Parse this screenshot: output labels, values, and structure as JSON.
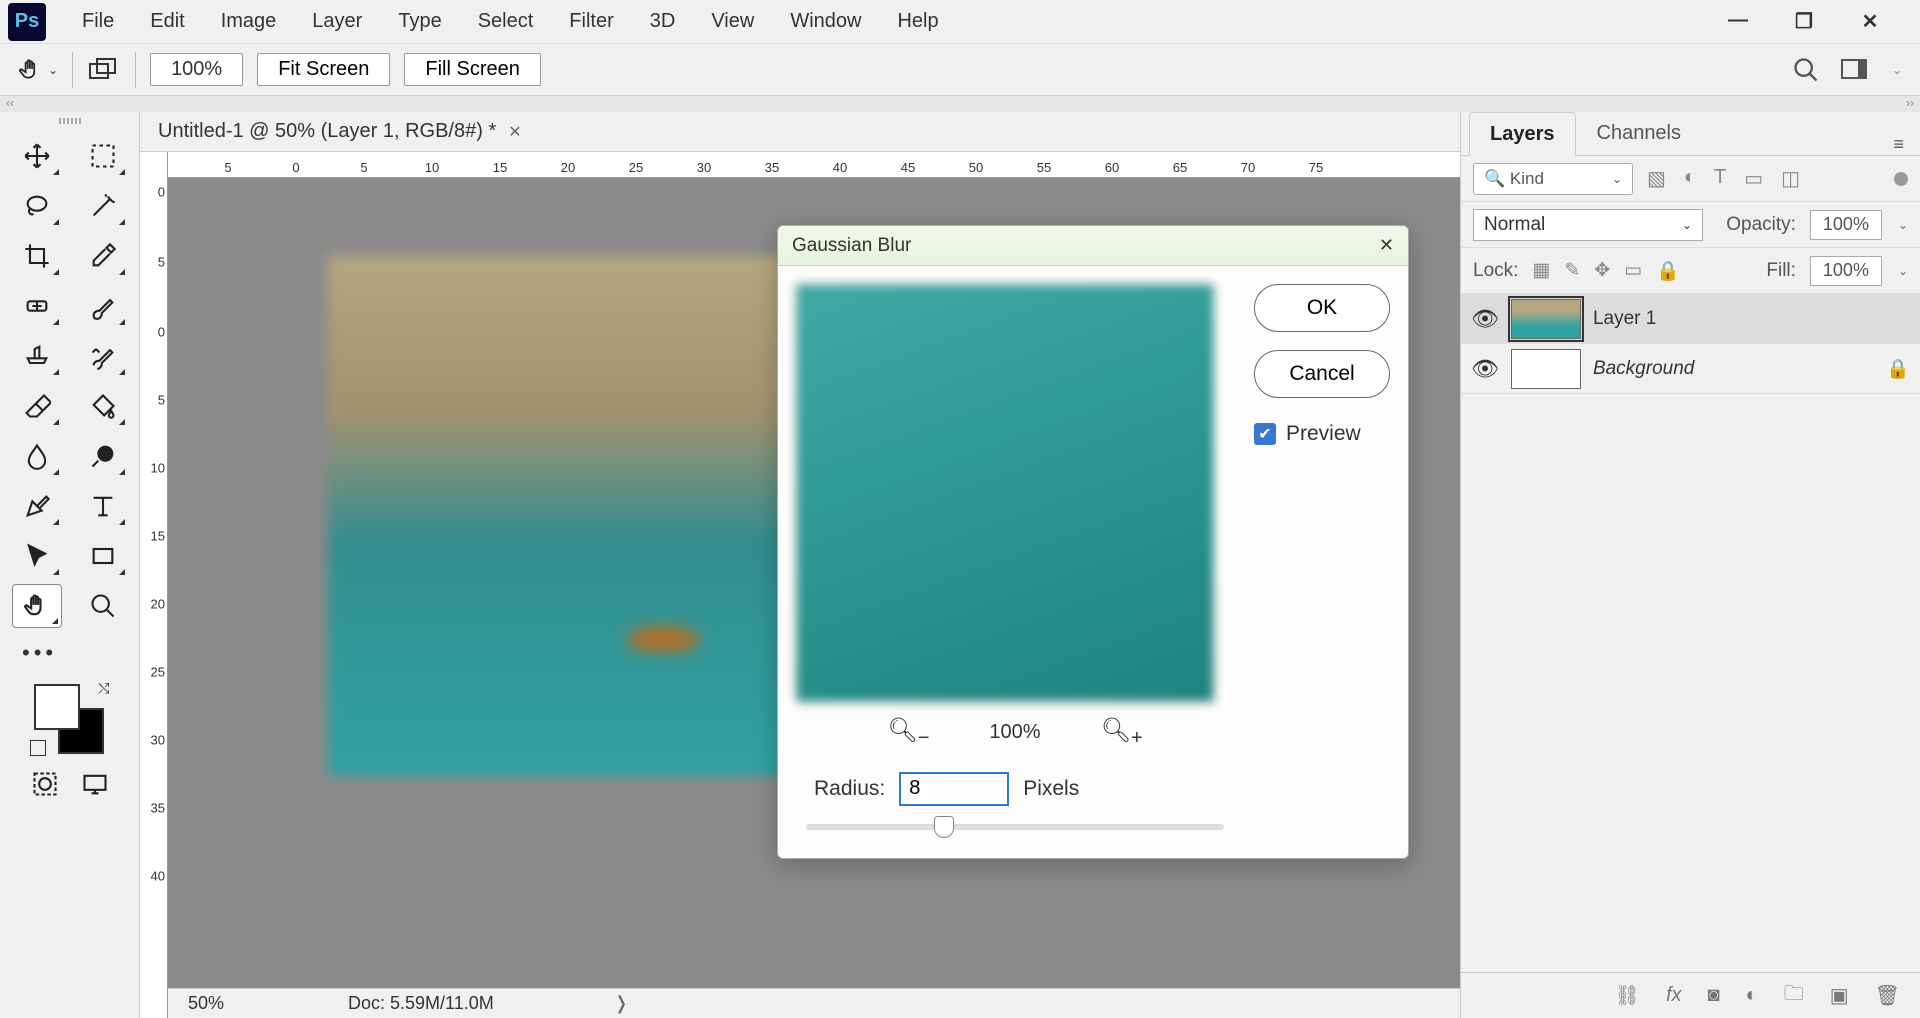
{
  "menu": {
    "items": [
      "File",
      "Edit",
      "Image",
      "Layer",
      "Type",
      "Select",
      "Filter",
      "3D",
      "View",
      "Window",
      "Help"
    ]
  },
  "options": {
    "zoom": "100%",
    "fit": "Fit Screen",
    "fill": "Fill Screen"
  },
  "document": {
    "tab": "Untitled-1 @ 50% (Layer 1, RGB/8#) *"
  },
  "ruler_h": [
    "",
    "5",
    "0",
    "5",
    "10",
    "15",
    "20",
    "25",
    "30",
    "35",
    "40",
    "45",
    "50",
    "55",
    "60",
    "65",
    "70",
    "75"
  ],
  "ruler_v": [
    "0",
    "5",
    "0",
    "5",
    "10",
    "15",
    "20",
    "25",
    "30",
    "35",
    "40"
  ],
  "status": {
    "zoom": "50%",
    "doc": "Doc: 5.59M/11.0M"
  },
  "dialog": {
    "title": "Gaussian Blur",
    "ok": "OK",
    "cancel": "Cancel",
    "preview": "Preview",
    "zoom": "100%",
    "radius_label": "Radius:",
    "radius_value": "8",
    "radius_unit": "Pixels"
  },
  "panels": {
    "tabs": {
      "layers": "Layers",
      "channels": "Channels"
    },
    "filter_kind": "Kind",
    "blend_mode": "Normal",
    "opacity_label": "Opacity:",
    "opacity_value": "100%",
    "lock_label": "Lock:",
    "fill_label": "Fill:",
    "fill_value": "100%",
    "layers": [
      {
        "name": "Layer 1",
        "selected": true,
        "locked": false
      },
      {
        "name": "Background",
        "selected": false,
        "locked": true,
        "italic": true
      }
    ]
  }
}
